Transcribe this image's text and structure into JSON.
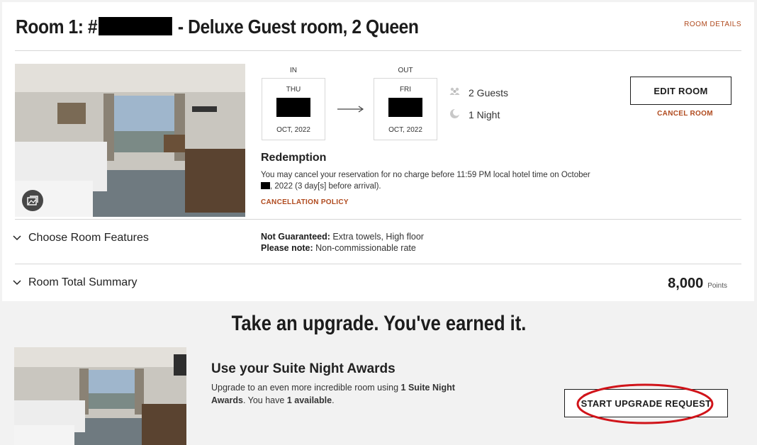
{
  "room": {
    "title_prefix": "Room 1: #",
    "title_suffix": " - Deluxe Guest room, 2 Queen",
    "details_link": "ROOM DETAILS"
  },
  "dates": {
    "in_label": "IN",
    "out_label": "OUT",
    "check_in": {
      "dow": "THU",
      "month": "OCT, 2022"
    },
    "check_out": {
      "dow": "FRI",
      "month": "OCT, 2022"
    }
  },
  "stay": {
    "guests": "2 Guests",
    "nights": "1 Night"
  },
  "actions": {
    "edit_room": "EDIT ROOM",
    "cancel_room": "CANCEL ROOM"
  },
  "redemption": {
    "title": "Redemption",
    "text_part1": "You may cancel your reservation for no charge before 11:59 PM local hotel time on October",
    "text_part2": ", 2022 (3 day[s] before arrival).",
    "policy_link": "CANCELLATION POLICY"
  },
  "features": {
    "label": "Choose Room Features",
    "not_guaranteed_label": "Not Guaranteed:",
    "not_guaranteed_value": " Extra towels, High floor",
    "note_label": "Please note:",
    "note_value": " Non-commissionable rate"
  },
  "summary": {
    "label": "Room Total Summary",
    "points_value": "8,000",
    "points_unit": "Points"
  },
  "upgrade": {
    "heading": "Take an upgrade. You've earned it.",
    "suite_title": "Use your Suite Night Awards",
    "text_a": "Upgrade to an even more incredible room using ",
    "text_b": "1 Suite Night Awards",
    "text_c": ". You have ",
    "text_d": "1 available",
    "text_e": ".",
    "button": "START UPGRADE REQUEST"
  },
  "colors": {
    "accent": "#b04a1e",
    "annotation": "#d0141a"
  },
  "icons": [
    "gallery-icon",
    "arrow-right-icon",
    "guests-icon",
    "moon-icon",
    "chevron-down-icon"
  ]
}
